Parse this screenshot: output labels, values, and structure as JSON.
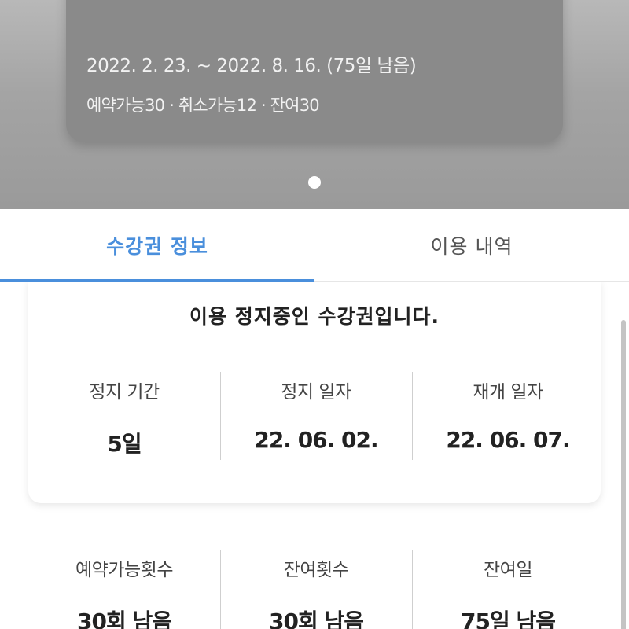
{
  "pass_card": {
    "period": "2022. 2. 23. ~ 2022. 8. 16. (75일 남음)",
    "counts": "예약가능30 · 취소가능12 · 잔여30"
  },
  "tabs": [
    {
      "label": "수강권 정보",
      "active": true
    },
    {
      "label": "이용 내역",
      "active": false
    }
  ],
  "pause_info": {
    "title": "이용 정지중인 수강권입니다.",
    "stats": [
      {
        "label": "정지 기간",
        "value": "5일"
      },
      {
        "label": "정지 일자",
        "value": "22. 06. 02."
      },
      {
        "label": "재개 일자",
        "value": "22. 06. 07."
      }
    ]
  },
  "usage_stats": [
    {
      "label": "예약가능횟수",
      "value": "30회 남음"
    },
    {
      "label": "잔여횟수",
      "value": "30회 남음"
    },
    {
      "label": "잔여일",
      "value": "75일 남음"
    }
  ],
  "colors": {
    "accent": "#4a8fdc",
    "hero_bg": "#a4a4a4",
    "pass_card_bg": "#8a8a8a"
  }
}
